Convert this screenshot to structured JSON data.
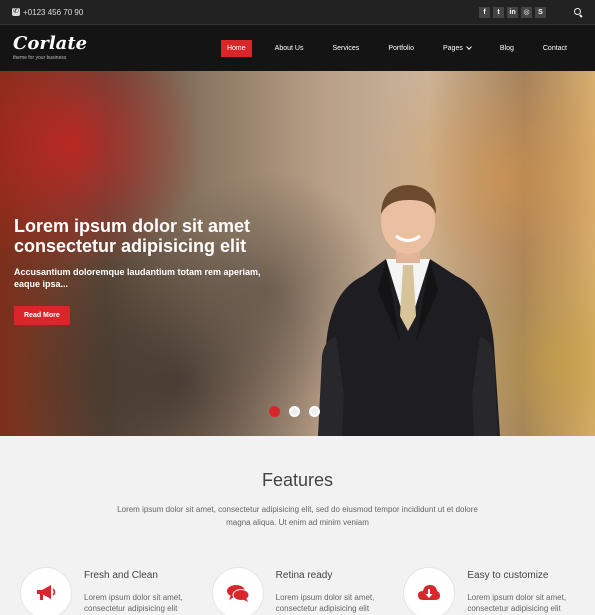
{
  "topbar": {
    "phone": "+0123 456 70 90",
    "social": [
      "f",
      "twitter",
      "in",
      "dribbble",
      "skype"
    ]
  },
  "header": {
    "logo": "Corlate",
    "tagline": "theme for your business",
    "nav": [
      "Home",
      "About Us",
      "Services",
      "Portfolio",
      "Pages",
      "Blog",
      "Contact"
    ],
    "active": "Home"
  },
  "hero": {
    "title": "Lorem ipsum dolor sit amet consectetur adipisicing elit",
    "subtitle": "Accusantium doloremque laudantium totam rem aperiam, eaque ipsa...",
    "button": "Read More",
    "slides": 3,
    "active_slide": 1
  },
  "features": {
    "title": "Features",
    "intro": "Lorem ipsum dolor sit amet, consectetur adipisicing elit, sed do eiusmod tempor incididunt ut et dolore magna aliqua. Ut enim ad minim veniam",
    "items": [
      {
        "title": "Fresh and Clean",
        "text": "Lorem ipsum dolor sit amet, consectetur adipisicing elit",
        "icon": "megaphone-icon"
      },
      {
        "title": "Retina ready",
        "text": "Lorem ipsum dolor sit amet, consectetur adipisicing elit",
        "icon": "chat-bubbles-icon"
      },
      {
        "title": "Easy to customize",
        "text": "Lorem ipsum dolor sit amet, consectetur adipisicing elit",
        "icon": "cloud-download-icon"
      }
    ]
  },
  "colors": {
    "accent": "#d9262b",
    "topbar": "#222222",
    "navbar": "#141414",
    "page": "#f2f2f2"
  }
}
